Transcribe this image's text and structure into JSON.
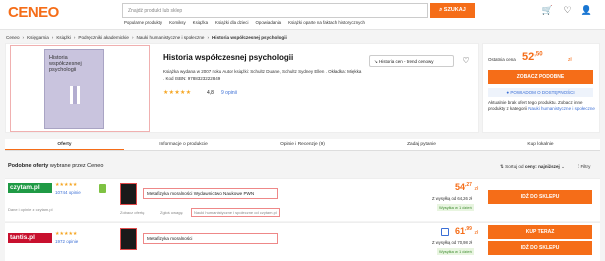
{
  "header": {
    "logo": "CENEO",
    "search_placeholder": "Znajdź produkt lub sklep",
    "search_button": "SZUKAJ",
    "categories": [
      "Popularne produkty",
      "Komiksy",
      "Książka",
      "Książki dla dzieci",
      "Opowiadania",
      "Książki oparte na faktach historycznych"
    ]
  },
  "breadcrumb": [
    "Ceneo",
    "Księgarnia",
    "Książki",
    "Podręczniki akademickie",
    "Nauki humanistyczne i społeczne",
    "Historia współczesnej psychologii"
  ],
  "product": {
    "title": "Historia współczesnej psychologii",
    "cover_title": "Historia współczesnej psychologii",
    "desc": "Książka wydana w 2007 roku Autor książki: Schultz Duane, Schultz Sydney Ellen . Okładka: Miękka . Kod ISBN: 9788323222849",
    "rating": "4,8",
    "reviews": "9 opinii",
    "stars": "★★★★★",
    "history_button": "Historia cen - trend cenowy"
  },
  "pricebox": {
    "label": "Ostatnia cena",
    "price_int": "52",
    "price_dec": ",50",
    "currency": "zł",
    "similar_button": "ZOBACZ PODOBNE",
    "notify": "POWIADOM O DOSTĘPNOŚCI",
    "info": "Aktualnie brak ofert tego produktu. Zobacz inne produkty z kategorii",
    "info_link": "Nauki humanistyczne i społeczne"
  },
  "tabs": [
    "Oferty",
    "Informacje o produkcie",
    "Opinie i Recenzje (9)",
    "Zadaj pytanie",
    "Kup lokalnie"
  ],
  "offers": {
    "heading_bold": "Podobne oferty",
    "heading": "wybrane przez Ceneo",
    "sort_label": "Sortuj od",
    "sort_value": "ceny: najniższej",
    "filter": "Filtry",
    "rows": [
      {
        "shop": "czytam.pl",
        "shop_color": "#1f9a45",
        "stars": "★★★★★",
        "opinions": "10744 opinie",
        "shop_note": "Dane i opinie z czytam.pl",
        "title": "Metafizyka moralności Wydawnictwo Naukowe PWN",
        "link1": "Zobacz ofertę",
        "link2": "Zgłoś uwagę",
        "category": "Nauki humanistyczne i społeczne od czytam.pl",
        "price_int": "54",
        "price_dec": ",27",
        "currency": "zł",
        "shipping": "Z wysyłką od 64,26 zł",
        "availability": "Wysyłka w 1 dzień",
        "button": "IDŹ DO SKLEPU"
      },
      {
        "shop": "tantis.pl",
        "shop_color": "#c8102e",
        "stars": "★★★★★",
        "opinions": "1972 opinie",
        "title": "Metafizyka moralności",
        "price_int": "61",
        "price_dec": ",99",
        "currency": "zł",
        "shipping": "Z wysyłką od 70,98 zł",
        "availability": "Wysyłka w 1 dzień",
        "buy_button": "KUP TERAZ",
        "button": "IDŹ DO SKLEPU"
      }
    ]
  }
}
